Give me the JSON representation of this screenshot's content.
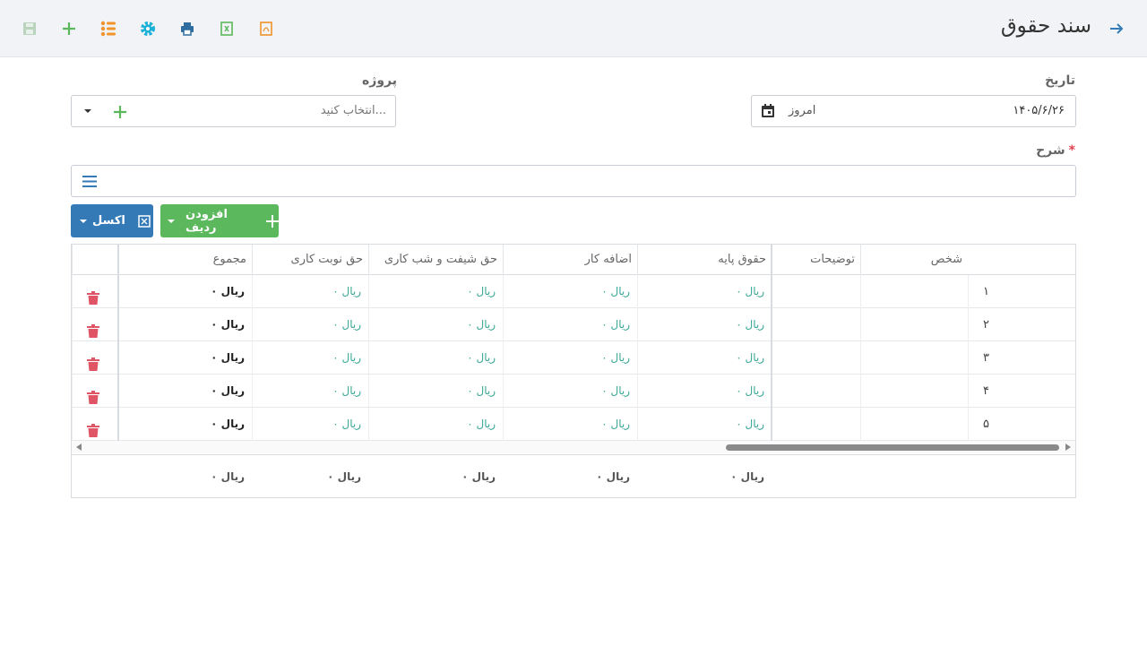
{
  "header": {
    "title": "سند حقوق",
    "toolbar": [
      "save-icon",
      "add-icon",
      "list-icon",
      "settings-icon",
      "print-icon",
      "excel-icon",
      "pdf-icon"
    ]
  },
  "form": {
    "date_label": "تاریخ",
    "date_value": "۱۴۰۵/۶/۲۶",
    "date_today": "امروز",
    "project_label": "پروژه",
    "project_placeholder": "انتخاب کنید...",
    "description_label": "شرح",
    "description_required": "*"
  },
  "buttons": {
    "add_row": "افزودن ردیف",
    "excel": "اکسل"
  },
  "table": {
    "columns": [
      "شخص",
      "توضیحات",
      "حقوق پایه",
      "اضافه کار",
      "حق شیفت و شب کاری",
      "حق نوبت کاری",
      "مجموع"
    ],
    "rows": [
      {
        "num": "۱",
        "base": "ریال ۰",
        "overtime": "ریال ۰",
        "shift": "ریال ۰",
        "turn": "ریال ۰",
        "total": "ریال ۰"
      },
      {
        "num": "۲",
        "base": "ریال ۰",
        "overtime": "ریال ۰",
        "shift": "ریال ۰",
        "turn": "ریال ۰",
        "total": "ریال ۰"
      },
      {
        "num": "۳",
        "base": "ریال ۰",
        "overtime": "ریال ۰",
        "shift": "ریال ۰",
        "turn": "ریال ۰",
        "total": "ریال ۰"
      },
      {
        "num": "۴",
        "base": "ریال ۰",
        "overtime": "ریال ۰",
        "shift": "ریال ۰",
        "turn": "ریال ۰",
        "total": "ریال ۰"
      },
      {
        "num": "۵",
        "base": "ریال ۰",
        "overtime": "ریال ۰",
        "shift": "ریال ۰",
        "turn": "ریال ۰",
        "total": "ریال ۰"
      }
    ],
    "footer": {
      "base": "ریال ۰",
      "overtime": "ریال ۰",
      "shift": "ریال ۰",
      "turn": "ریال ۰",
      "total": "ریال ۰"
    }
  },
  "colors": {
    "accent_blue": "#337ab7",
    "accent_green": "#5cb85c",
    "rial_teal": "#3aa796",
    "danger": "#e05565"
  }
}
